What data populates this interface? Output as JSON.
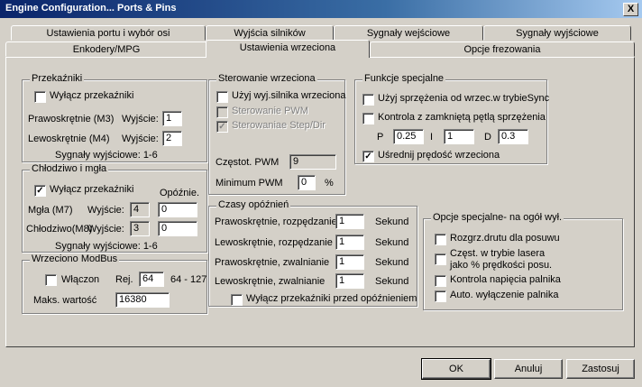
{
  "window": {
    "title": "Engine Configuration... Ports & Pins",
    "close": "X"
  },
  "tabs": {
    "row1": [
      "Ustawienia portu i wybór osi",
      "Wyjścia silników",
      "Sygnały wejściowe",
      "Sygnały wyjściowe"
    ],
    "row2": [
      "Enkodery/MPG",
      "Ustawienia wrzeciona",
      "Opcje frezowania"
    ]
  },
  "relays": {
    "title": "Przekaźniki",
    "disable_label": "Wyłącz przekaźniki",
    "cw_label": "Prawoskrętnie (M3)",
    "ccw_label": "Lewoskrętnie (M4)",
    "output_label": "Wyjście:",
    "cw_output": "1",
    "ccw_output": "2",
    "outputs_note": "Sygnały wyjściowe: 1-6"
  },
  "coolant": {
    "title": "Chłodziwo i mgła",
    "disable_label": "Wyłącz przekaźniki",
    "delay_label": "Opóźnie.",
    "mist_label": "Mgła (M7)",
    "flood_label": "Chłodziwo(M8)",
    "output_label": "Wyjście:",
    "mist_output": "4",
    "flood_output": "3",
    "mist_delay": "0",
    "flood_delay": "0",
    "outputs_note": "Sygnały wyjściowe: 1-6"
  },
  "modbus": {
    "title": "Wrzeciono ModBus",
    "enabled_label": "Włączon",
    "reg_label": "Rej.",
    "reg_value": "64",
    "reg_range": "64 - 127",
    "max_label": "Maks. wartość",
    "max_value": "16380"
  },
  "spindle_control": {
    "title": "Sterowanie wrzeciona",
    "use_motor_label": "Użyj wyj.silnika wrzeciona",
    "pwm_label": "Sterowanie PWM",
    "stepdir_label": "Sterowaniae Step/Dir",
    "pwm_freq_label": "Częstot. PWM",
    "pwm_freq_value": "9",
    "pwm_min_label": "Minimum PWM",
    "pwm_min_value": "0",
    "percent": "%"
  },
  "special": {
    "title": "Funkcje specjalne",
    "sync_label": "Użyj sprzężenia od wrzec.w trybieSync",
    "closed_loop_label": "Kontrola z zamkniętą pętlą sprzężenia",
    "p_label": "P",
    "p_value": "0.25",
    "i_label": "I",
    "i_value": "1",
    "d_label": "D",
    "d_value": "0.3",
    "average_label": "Uśrednij prędość wrzeciona"
  },
  "delays": {
    "title": "Czasy opóźnień",
    "rows": [
      {
        "label": "Prawoskrętnie, rozpędzanie",
        "value": "1",
        "unit": "Sekund"
      },
      {
        "label": "Lewoskrętnie, rozpędzanie",
        "value": "1",
        "unit": "Sekund"
      },
      {
        "label": "Prawoskrętnie, zwalnianie",
        "value": "1",
        "unit": "Sekund"
      },
      {
        "label": "Lewoskrętnie, zwalnianie",
        "value": "1",
        "unit": "Sekund"
      }
    ],
    "disable_before_label": "Wyłącz przekaźniki przed opóźnieniem"
  },
  "general": {
    "title": "Opcje specjalne- na ogół wył.",
    "wire_label": "Rozgrz.drutu dla posuwu",
    "laser_label1": "Częst. w trybie lasera",
    "laser_label2": "jako % prędkości posu.",
    "voltage_label": "Kontrola napięcia palnika",
    "torch_off_label": "Auto. wyłączenie palnika"
  },
  "buttons": {
    "ok": "OK",
    "cancel": "Anuluj",
    "apply": "Zastosuj"
  }
}
